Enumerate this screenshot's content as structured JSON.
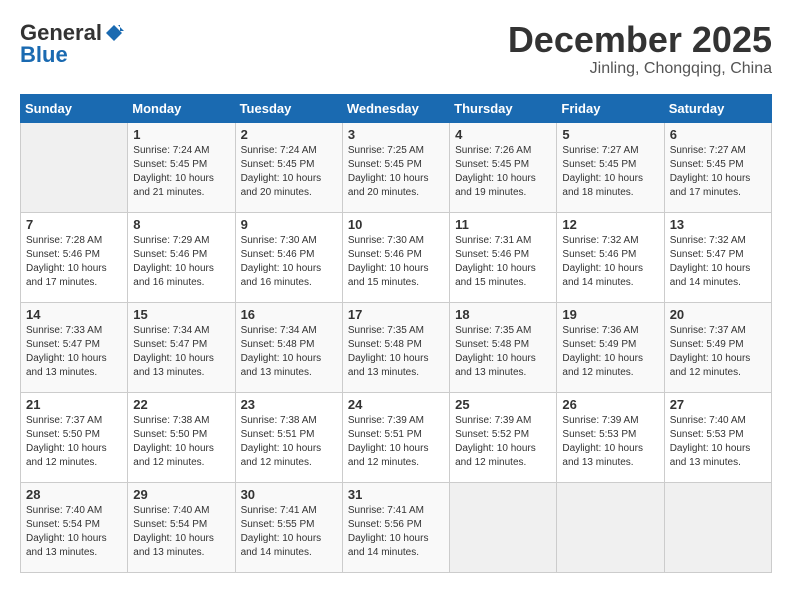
{
  "header": {
    "logo_general": "General",
    "logo_blue": "Blue",
    "month": "December 2025",
    "location": "Jinling, Chongqing, China"
  },
  "calendar": {
    "days_of_week": [
      "Sunday",
      "Monday",
      "Tuesday",
      "Wednesday",
      "Thursday",
      "Friday",
      "Saturday"
    ],
    "weeks": [
      [
        {
          "day": "",
          "info": ""
        },
        {
          "day": "1",
          "info": "Sunrise: 7:24 AM\nSunset: 5:45 PM\nDaylight: 10 hours\nand 21 minutes."
        },
        {
          "day": "2",
          "info": "Sunrise: 7:24 AM\nSunset: 5:45 PM\nDaylight: 10 hours\nand 20 minutes."
        },
        {
          "day": "3",
          "info": "Sunrise: 7:25 AM\nSunset: 5:45 PM\nDaylight: 10 hours\nand 20 minutes."
        },
        {
          "day": "4",
          "info": "Sunrise: 7:26 AM\nSunset: 5:45 PM\nDaylight: 10 hours\nand 19 minutes."
        },
        {
          "day": "5",
          "info": "Sunrise: 7:27 AM\nSunset: 5:45 PM\nDaylight: 10 hours\nand 18 minutes."
        },
        {
          "day": "6",
          "info": "Sunrise: 7:27 AM\nSunset: 5:45 PM\nDaylight: 10 hours\nand 17 minutes."
        }
      ],
      [
        {
          "day": "7",
          "info": "Sunrise: 7:28 AM\nSunset: 5:46 PM\nDaylight: 10 hours\nand 17 minutes."
        },
        {
          "day": "8",
          "info": "Sunrise: 7:29 AM\nSunset: 5:46 PM\nDaylight: 10 hours\nand 16 minutes."
        },
        {
          "day": "9",
          "info": "Sunrise: 7:30 AM\nSunset: 5:46 PM\nDaylight: 10 hours\nand 16 minutes."
        },
        {
          "day": "10",
          "info": "Sunrise: 7:30 AM\nSunset: 5:46 PM\nDaylight: 10 hours\nand 15 minutes."
        },
        {
          "day": "11",
          "info": "Sunrise: 7:31 AM\nSunset: 5:46 PM\nDaylight: 10 hours\nand 15 minutes."
        },
        {
          "day": "12",
          "info": "Sunrise: 7:32 AM\nSunset: 5:46 PM\nDaylight: 10 hours\nand 14 minutes."
        },
        {
          "day": "13",
          "info": "Sunrise: 7:32 AM\nSunset: 5:47 PM\nDaylight: 10 hours\nand 14 minutes."
        }
      ],
      [
        {
          "day": "14",
          "info": "Sunrise: 7:33 AM\nSunset: 5:47 PM\nDaylight: 10 hours\nand 13 minutes."
        },
        {
          "day": "15",
          "info": "Sunrise: 7:34 AM\nSunset: 5:47 PM\nDaylight: 10 hours\nand 13 minutes."
        },
        {
          "day": "16",
          "info": "Sunrise: 7:34 AM\nSunset: 5:48 PM\nDaylight: 10 hours\nand 13 minutes."
        },
        {
          "day": "17",
          "info": "Sunrise: 7:35 AM\nSunset: 5:48 PM\nDaylight: 10 hours\nand 13 minutes."
        },
        {
          "day": "18",
          "info": "Sunrise: 7:35 AM\nSunset: 5:48 PM\nDaylight: 10 hours\nand 13 minutes."
        },
        {
          "day": "19",
          "info": "Sunrise: 7:36 AM\nSunset: 5:49 PM\nDaylight: 10 hours\nand 12 minutes."
        },
        {
          "day": "20",
          "info": "Sunrise: 7:37 AM\nSunset: 5:49 PM\nDaylight: 10 hours\nand 12 minutes."
        }
      ],
      [
        {
          "day": "21",
          "info": "Sunrise: 7:37 AM\nSunset: 5:50 PM\nDaylight: 10 hours\nand 12 minutes."
        },
        {
          "day": "22",
          "info": "Sunrise: 7:38 AM\nSunset: 5:50 PM\nDaylight: 10 hours\nand 12 minutes."
        },
        {
          "day": "23",
          "info": "Sunrise: 7:38 AM\nSunset: 5:51 PM\nDaylight: 10 hours\nand 12 minutes."
        },
        {
          "day": "24",
          "info": "Sunrise: 7:39 AM\nSunset: 5:51 PM\nDaylight: 10 hours\nand 12 minutes."
        },
        {
          "day": "25",
          "info": "Sunrise: 7:39 AM\nSunset: 5:52 PM\nDaylight: 10 hours\nand 12 minutes."
        },
        {
          "day": "26",
          "info": "Sunrise: 7:39 AM\nSunset: 5:53 PM\nDaylight: 10 hours\nand 13 minutes."
        },
        {
          "day": "27",
          "info": "Sunrise: 7:40 AM\nSunset: 5:53 PM\nDaylight: 10 hours\nand 13 minutes."
        }
      ],
      [
        {
          "day": "28",
          "info": "Sunrise: 7:40 AM\nSunset: 5:54 PM\nDaylight: 10 hours\nand 13 minutes."
        },
        {
          "day": "29",
          "info": "Sunrise: 7:40 AM\nSunset: 5:54 PM\nDaylight: 10 hours\nand 13 minutes."
        },
        {
          "day": "30",
          "info": "Sunrise: 7:41 AM\nSunset: 5:55 PM\nDaylight: 10 hours\nand 14 minutes."
        },
        {
          "day": "31",
          "info": "Sunrise: 7:41 AM\nSunset: 5:56 PM\nDaylight: 10 hours\nand 14 minutes."
        },
        {
          "day": "",
          "info": ""
        },
        {
          "day": "",
          "info": ""
        },
        {
          "day": "",
          "info": ""
        }
      ]
    ]
  }
}
